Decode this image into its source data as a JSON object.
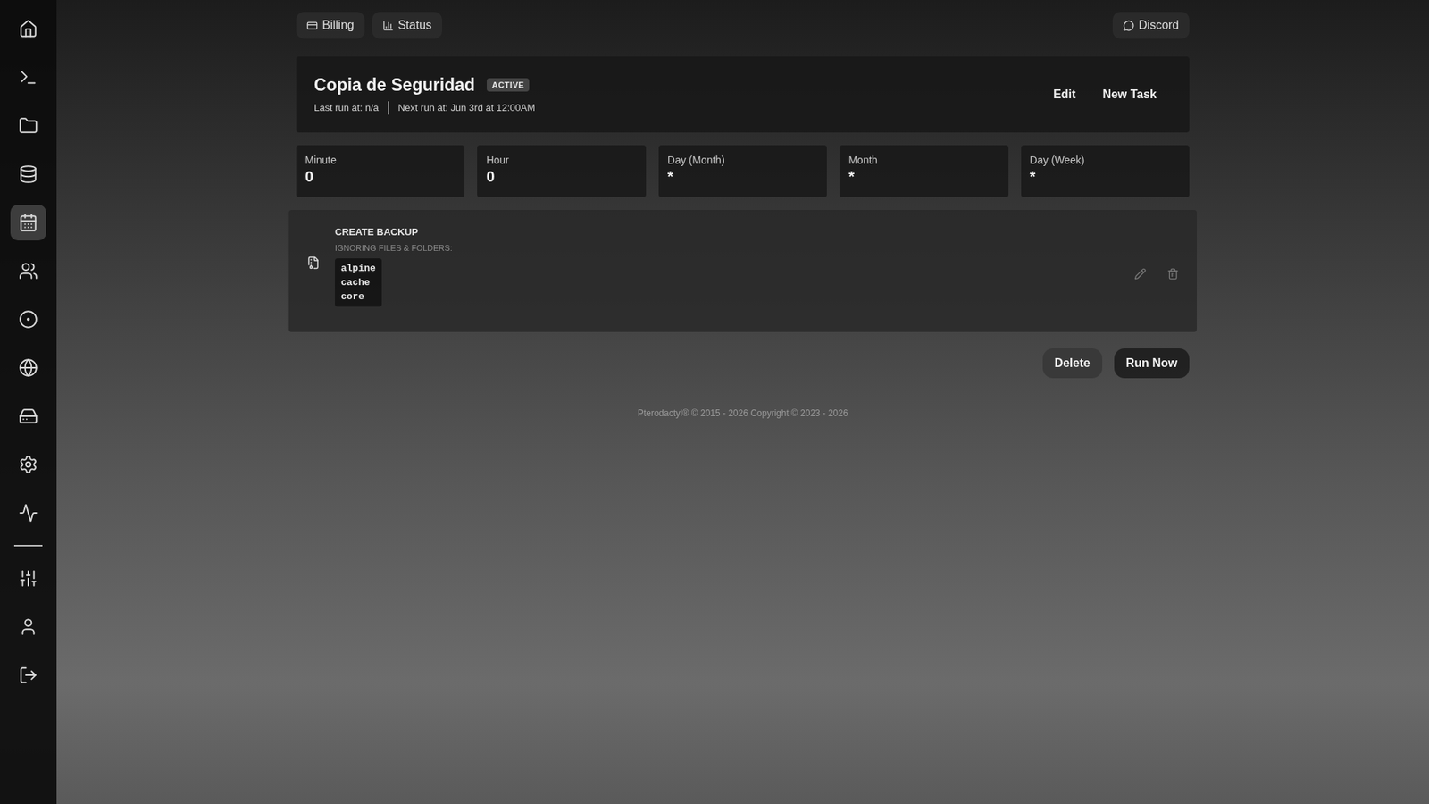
{
  "sidebar": {
    "items": [
      {
        "selected": false
      },
      {
        "selected": false
      },
      {
        "selected": false
      },
      {
        "selected": false
      },
      {
        "selected": true
      },
      {
        "selected": false
      },
      {
        "selected": false
      },
      {
        "selected": false
      },
      {
        "selected": false
      },
      {
        "selected": false
      },
      {
        "selected": false
      }
    ],
    "account_items": [
      {
        "selected": false
      },
      {
        "selected": false
      },
      {
        "selected": false
      }
    ]
  },
  "top_nav": {
    "left": [
      "Billing",
      "Status"
    ],
    "right": "Discord"
  },
  "schedule": {
    "name": "Copia de Seguridad",
    "badge": "ACTIVE",
    "last_run": "Last run at: n/a",
    "next_run": "Next run at: Jun 3rd at 12:00AM",
    "buttons": [
      "Edit",
      "New Task"
    ]
  },
  "cron": [
    {
      "label": "Minute",
      "value": "0"
    },
    {
      "label": "Hour",
      "value": "0"
    },
    {
      "label": "Day (Month)",
      "value": "*"
    },
    {
      "label": "Month",
      "value": "*"
    },
    {
      "label": "Day (Week)",
      "value": "*"
    }
  ],
  "task": {
    "title": "CREATE BACKUP",
    "subtitle": "IGNORING FILES & FOLDERS:",
    "files": [
      "alpine",
      "cache",
      "core"
    ]
  },
  "actions": [
    "Delete",
    "Run Now"
  ],
  "footer": "Pterodactyl® © 2015 - 2026 Copyright © 2023 - 2026"
}
